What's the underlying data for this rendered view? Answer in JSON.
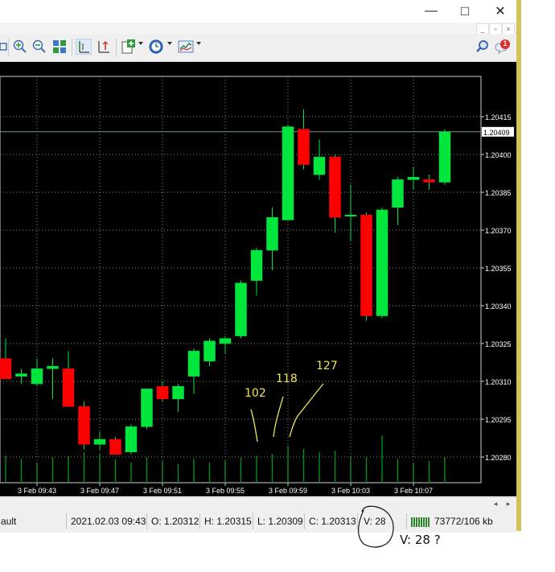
{
  "window": {
    "minimize_glyph": "—",
    "maximize_glyph": "□",
    "close_glyph": "✕",
    "mdi_minimize_glyph": "_",
    "mdi_restore_glyph": "▫",
    "mdi_close_glyph": "×"
  },
  "toolbar": {
    "icons": [
      "crosshair-icon",
      "zoom-in-icon",
      "zoom-out-icon",
      "tile-windows-icon",
      "period-separators-icon",
      "chart-shift-icon",
      "indicators-icon",
      "periods-icon",
      "templates-icon"
    ],
    "search_icon": "search-icon",
    "notification_badge": "1"
  },
  "colors": {
    "background": "#000000",
    "grid": "#8a8a8a",
    "bull": "#00e63c",
    "bear": "#ff0000",
    "volume": "#0b8f1a",
    "axis_text": "#ffffff",
    "annotation": "#f2e35a"
  },
  "chart_data": {
    "type": "candlestick",
    "instrument_timeframe": "1-minute bars",
    "y_ticks": [
      "1.20415",
      "1.20400",
      "1.20385",
      "1.20370",
      "1.20355",
      "1.20340",
      "1.20325",
      "1.20310",
      "1.20295",
      "1.20280"
    ],
    "ylim": [
      1.20272,
      1.2043
    ],
    "x_ticks": [
      "3 Feb 09:43",
      "3 Feb 09:47",
      "3 Feb 09:51",
      "3 Feb 09:55",
      "3 Feb 09:59",
      "3 Feb 10:03",
      "3 Feb 10:07"
    ],
    "current_price_label": "1.20409",
    "current_price": 1.20409,
    "grid": true,
    "candles": [
      {
        "o": 1.20319,
        "h": 1.20327,
        "l": 1.20311,
        "c": 1.20311
      },
      {
        "o": 1.20312,
        "h": 1.20315,
        "l": 1.20309,
        "c": 1.20313
      },
      {
        "o": 1.20309,
        "h": 1.20319,
        "l": 1.20308,
        "c": 1.20315
      },
      {
        "o": 1.20315,
        "h": 1.20319,
        "l": 1.20303,
        "c": 1.20316
      },
      {
        "o": 1.20315,
        "h": 1.20322,
        "l": 1.203,
        "c": 1.203
      },
      {
        "o": 1.203,
        "h": 1.20302,
        "l": 1.20283,
        "c": 1.20285
      },
      {
        "o": 1.20285,
        "h": 1.2029,
        "l": 1.20283,
        "c": 1.20287
      },
      {
        "o": 1.20287,
        "h": 1.20288,
        "l": 1.20281,
        "c": 1.20281
      },
      {
        "o": 1.20282,
        "h": 1.20293,
        "l": 1.20281,
        "c": 1.20292
      },
      {
        "o": 1.20292,
        "h": 1.20307,
        "l": 1.20291,
        "c": 1.20307
      },
      {
        "o": 1.20308,
        "h": 1.2031,
        "l": 1.20302,
        "c": 1.20303
      },
      {
        "o": 1.20303,
        "h": 1.20309,
        "l": 1.20298,
        "c": 1.20308
      },
      {
        "o": 1.20312,
        "h": 1.20323,
        "l": 1.20305,
        "c": 1.20322
      },
      {
        "o": 1.20318,
        "h": 1.20327,
        "l": 1.20316,
        "c": 1.20326
      },
      {
        "o": 1.20325,
        "h": 1.20328,
        "l": 1.20321,
        "c": 1.20327
      },
      {
        "o": 1.20328,
        "h": 1.2035,
        "l": 1.20327,
        "c": 1.20349
      },
      {
        "o": 1.2035,
        "h": 1.20363,
        "l": 1.20344,
        "c": 1.20362
      },
      {
        "o": 1.20362,
        "h": 1.20379,
        "l": 1.20354,
        "c": 1.20375
      },
      {
        "o": 1.20374,
        "h": 1.20412,
        "l": 1.20374,
        "c": 1.20411
      },
      {
        "o": 1.2041,
        "h": 1.20418,
        "l": 1.20394,
        "c": 1.20396
      },
      {
        "o": 1.20392,
        "h": 1.20406,
        "l": 1.2039,
        "c": 1.20399
      },
      {
        "o": 1.20399,
        "h": 1.204,
        "l": 1.20369,
        "c": 1.20375
      },
      {
        "o": 1.20376,
        "h": 1.20388,
        "l": 1.20366,
        "c": 1.20376
      },
      {
        "o": 1.20376,
        "h": 1.20377,
        "l": 1.20334,
        "c": 1.20336
      },
      {
        "o": 1.20336,
        "h": 1.20379,
        "l": 1.20335,
        "c": 1.20378
      },
      {
        "o": 1.20379,
        "h": 1.20391,
        "l": 1.20372,
        "c": 1.2039
      },
      {
        "o": 1.2039,
        "h": 1.20395,
        "l": 1.20386,
        "c": 1.20391
      },
      {
        "o": 1.2039,
        "h": 1.20392,
        "l": 1.20386,
        "c": 1.20389
      },
      {
        "o": 1.20389,
        "h": 1.2041,
        "l": 1.20388,
        "c": 1.20409
      }
    ],
    "volumes": [
      16,
      14,
      12,
      15,
      16,
      18,
      17,
      14,
      12,
      15,
      13,
      11,
      14,
      12,
      13,
      15,
      16,
      17,
      22,
      20,
      18,
      19,
      16,
      15,
      28,
      14,
      12,
      13,
      15
    ],
    "annotations": [
      "102",
      "118",
      "127"
    ]
  },
  "scrollbar": {
    "left_glyph": "◂",
    "right_glyph": "▸"
  },
  "status": {
    "profile": "ault",
    "datetime": "2021.02.03 09:43",
    "open": "O: 1.20312",
    "high": "H: 1.20315",
    "low": "L: 1.20309",
    "close": "C: 1.20313",
    "volume": "V: 28",
    "traffic": "73772/106 kb"
  },
  "handwritten_note": "V: 28 ?"
}
